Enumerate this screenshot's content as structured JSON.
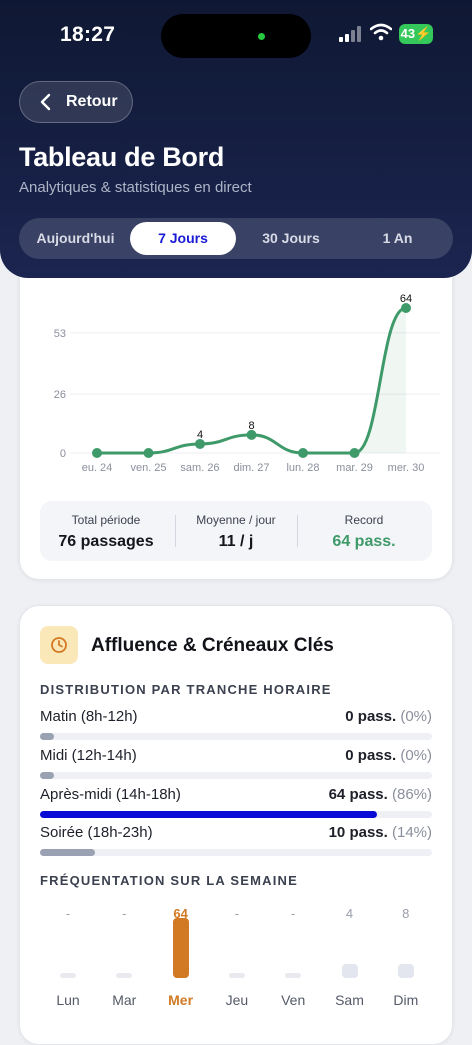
{
  "status_bar": {
    "time": "18:27",
    "battery": "43"
  },
  "header": {
    "back_label": "Retour",
    "title": "Tableau de Bord",
    "subtitle": "Analytiques & statistiques en direct",
    "periods": [
      "Aujourd'hui",
      "7 Jours",
      "30 Jours",
      "1 An"
    ],
    "active_period": "7 Jours"
  },
  "chart_data": {
    "type": "line",
    "x": [
      "eu. 24",
      "ven. 25",
      "sam. 26",
      "dim. 27",
      "lun. 28",
      "mar. 29",
      "mer. 30"
    ],
    "values": [
      0,
      0,
      4,
      8,
      0,
      0,
      64
    ],
    "point_labels": [
      "",
      "",
      "4",
      "8",
      "",
      "",
      "64"
    ],
    "yticks": [
      "0",
      "26",
      "53"
    ],
    "ylim": [
      0,
      64
    ],
    "color": "#3f9a6a"
  },
  "summary": {
    "total_label": "Total période",
    "total_value": "76 passages",
    "avg_label": "Moyenne / jour",
    "avg_value": "11 / j",
    "record_label": "Record",
    "record_value": "64 pass."
  },
  "affluence": {
    "title": "Affluence & Créneaux Clés",
    "distribution_label": "DISTRIBUTION PAR TRANCHE HORAIRE",
    "slots": [
      {
        "name": "Matin (8h-12h)",
        "value": "0 pass.",
        "pct": "(0%)",
        "fraction": 0,
        "color": "#9aa1b2"
      },
      {
        "name": "Midi (12h-14h)",
        "value": "0 pass.",
        "pct": "(0%)",
        "fraction": 0,
        "color": "#9aa1b2"
      },
      {
        "name": "Après-midi (14h-18h)",
        "value": "64 pass.",
        "pct": "(86%)",
        "fraction": 0.86,
        "color": "#0a0ad6"
      },
      {
        "name": "Soirée (18h-23h)",
        "value": "10 pass.",
        "pct": "(14%)",
        "fraction": 0.14,
        "color": "#9aa1b2"
      }
    ],
    "week_label": "FRÉQUENTATION SUR LA SEMAINE",
    "week": [
      {
        "day": "Lun",
        "count": "-",
        "value": 0
      },
      {
        "day": "Mar",
        "count": "-",
        "value": 0
      },
      {
        "day": "Mer",
        "count": "64",
        "value": 64,
        "today": true
      },
      {
        "day": "Jeu",
        "count": "-",
        "value": 0
      },
      {
        "day": "Ven",
        "count": "-",
        "value": 0
      },
      {
        "day": "Sam",
        "count": "4",
        "value": 4
      },
      {
        "day": "Dim",
        "count": "8",
        "value": 8
      }
    ],
    "accent": "#d27a23"
  }
}
